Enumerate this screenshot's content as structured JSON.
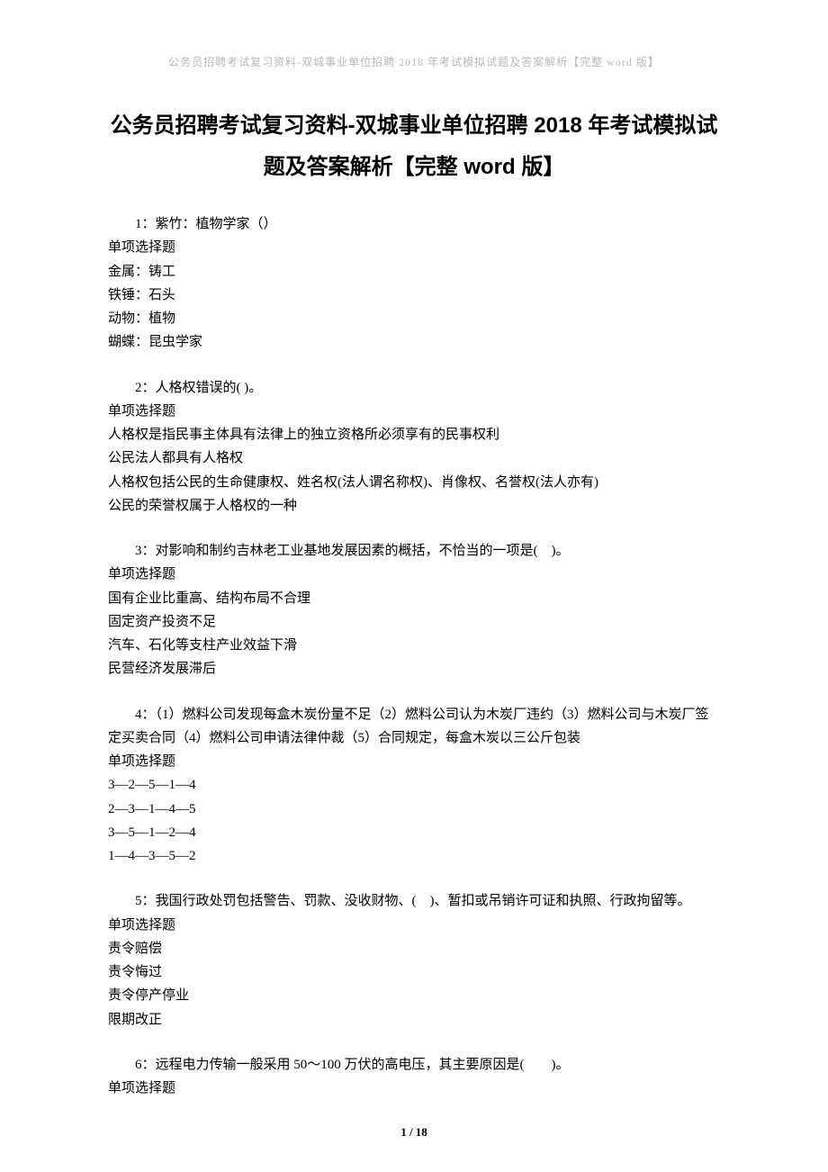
{
  "header": "公务员招聘考试复习资料-双城事业单位招聘 2018 年考试模拟试题及答案解析【完整 word 版】",
  "title": "公务员招聘考试复习资料-双城事业单位招聘 2018 年考试模拟试题及答案解析【完整 word 版】",
  "questions": [
    {
      "stem": "1：紫竹：植物学家（）",
      "type": "单项选择题",
      "options": [
        "金属：铸工",
        "铁锤：石头",
        "动物：植物",
        "蝴蝶：昆虫学家"
      ]
    },
    {
      "stem": "2：人格权错误的( )。",
      "type": "单项选择题",
      "options": [
        "人格权是指民事主体具有法律上的独立资格所必须享有的民事权利",
        "公民法人都具有人格权",
        "人格权包括公民的生命健康权、姓名权(法人谓名称权)、肖像权、名誉权(法人亦有)",
        "公民的荣誉权属于人格权的一种"
      ]
    },
    {
      "stem": "3：对影响和制约吉林老工业基地发展因素的概括，不恰当的一项是(　)。",
      "type": "单项选择题",
      "options": [
        "国有企业比重高、结构布局不合理",
        "固定资产投资不足",
        "汽车、石化等支柱产业效益下滑",
        "民营经济发展滞后"
      ]
    },
    {
      "stem": "4：（1）燃料公司发现每盒木炭份量不足（2）燃料公司认为木炭厂违约（3）燃料公司与木炭厂签定买卖合同（4）燃料公司申请法律仲裁（5）合同规定，每盒木炭以三公斤包装",
      "type": "单项选择题",
      "options": [
        "3—2—5—1—4",
        "2—3—1—4—5",
        "3—5—1—2—4",
        "1—4—3—5—2"
      ]
    },
    {
      "stem": "5：我国行政处罚包括警告、罚款、没收财物、(　)、暂扣或吊销许可证和执照、行政拘留等。",
      "type": "单项选择题",
      "options": [
        "责令赔偿",
        "责令悔过",
        "责令停产停业",
        "限期改正"
      ]
    },
    {
      "stem": "6：远程电力传输一般采用 50～100 万伏的高电压，其主要原因是(　　)。",
      "type": "单项选择题",
      "options": []
    }
  ],
  "footer": "1 / 18"
}
